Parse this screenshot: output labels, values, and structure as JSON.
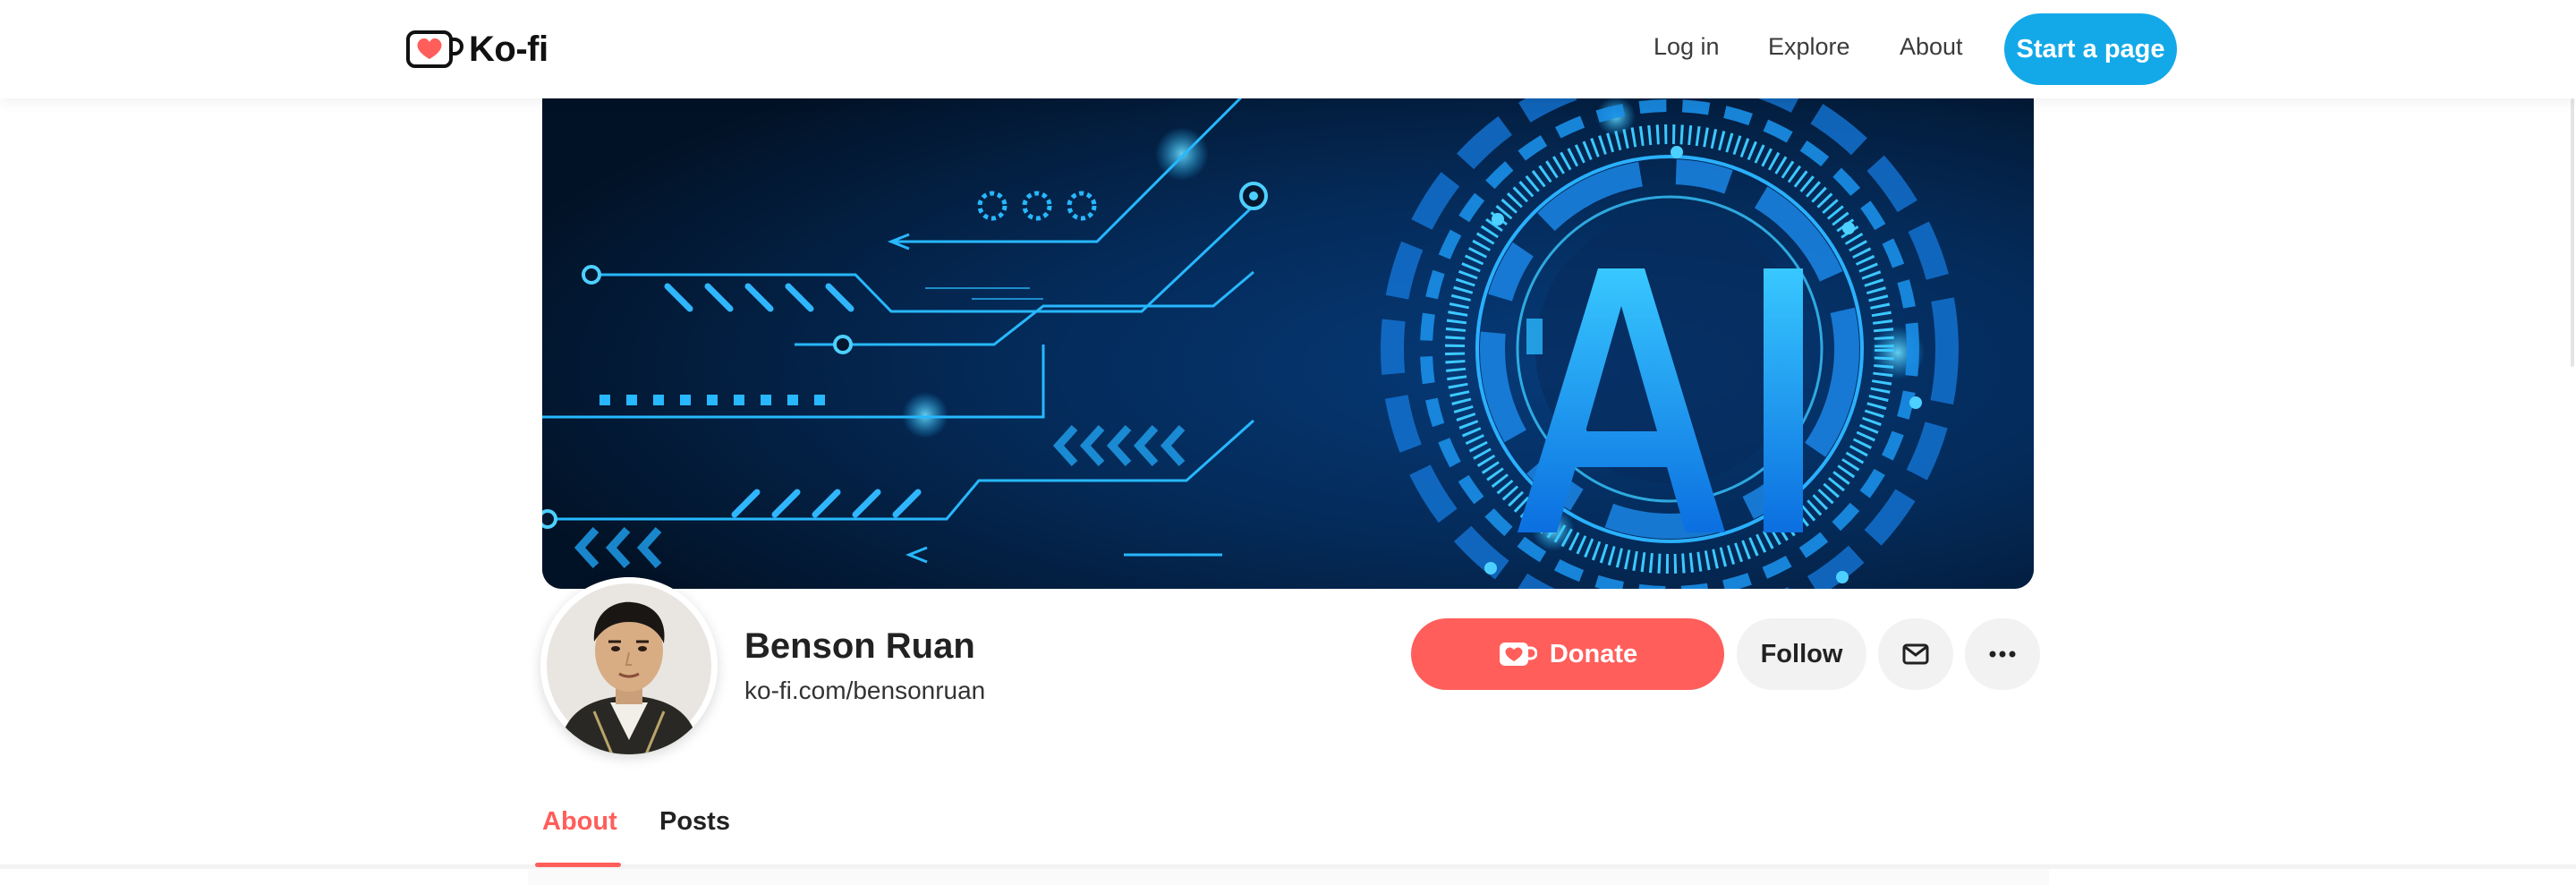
{
  "header": {
    "brand": "Ko-fi",
    "nav": {
      "login": "Log in",
      "explore": "Explore",
      "about": "About"
    },
    "cta": "Start a page"
  },
  "banner": {
    "text": "AI",
    "colors": {
      "background": "#04172f",
      "glow": "#1fb6ff",
      "accent": "#4dd0ff"
    }
  },
  "profile": {
    "name": "Benson Ruan",
    "url": "ko-fi.com/bensonruan"
  },
  "actions": {
    "donate": "Donate",
    "follow": "Follow",
    "message_icon": "envelope-icon",
    "more_icon": "ellipsis-icon"
  },
  "tabs": [
    {
      "label": "About",
      "active": true
    },
    {
      "label": "Posts",
      "active": false
    }
  ],
  "colors": {
    "brand_red": "#ff5e5b",
    "brand_blue": "#13a9e8"
  }
}
